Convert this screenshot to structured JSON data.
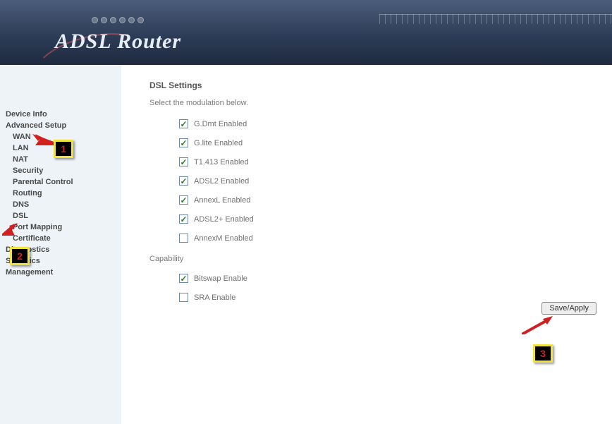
{
  "header": {
    "title": "ADSL Router"
  },
  "sidebar": {
    "items": [
      {
        "label": "Device Info",
        "child": false
      },
      {
        "label": "Advanced Setup",
        "child": false
      },
      {
        "label": "WAN",
        "child": true
      },
      {
        "label": "LAN",
        "child": true
      },
      {
        "label": "NAT",
        "child": true
      },
      {
        "label": "Security",
        "child": true
      },
      {
        "label": "Parental Control",
        "child": true
      },
      {
        "label": "Routing",
        "child": true
      },
      {
        "label": "DNS",
        "child": true
      },
      {
        "label": "DSL",
        "child": true
      },
      {
        "label": "Port Mapping",
        "child": true
      },
      {
        "label": "Certificate",
        "child": true
      },
      {
        "label": "Diagnostics",
        "child": false
      },
      {
        "label": "Statistics",
        "child": false
      },
      {
        "label": "Management",
        "child": false
      }
    ]
  },
  "main": {
    "heading": "DSL Settings",
    "instruction": "Select the modulation below.",
    "modulation": [
      {
        "label": "G.Dmt Enabled",
        "checked": true
      },
      {
        "label": "G.lite Enabled",
        "checked": true
      },
      {
        "label": "T1.413 Enabled",
        "checked": true
      },
      {
        "label": "ADSL2 Enabled",
        "checked": true
      },
      {
        "label": "AnnexL Enabled",
        "checked": true
      },
      {
        "label": "ADSL2+ Enabled",
        "checked": true
      },
      {
        "label": "AnnexM Enabled",
        "checked": false
      }
    ],
    "capability_heading": "Capability",
    "capability": [
      {
        "label": "Bitswap Enable",
        "checked": true
      },
      {
        "label": "SRA Enable",
        "checked": false
      }
    ],
    "apply_button": "Save/Apply"
  },
  "annotations": {
    "c1": "1",
    "c2": "2",
    "c3": "3"
  }
}
